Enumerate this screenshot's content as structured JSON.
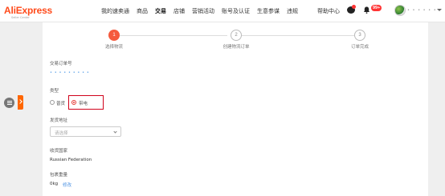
{
  "header": {
    "logo_text": "AliExpress",
    "logo_sub": "Seller Center",
    "nav": [
      "我的速卖通",
      "商品",
      "交易",
      "店铺",
      "营销活动",
      "账号及认证",
      "生意参谋",
      "违规"
    ],
    "active_nav": "交易",
    "help": "帮助中心",
    "notification_badge": "99+",
    "username_masked": "• • • • • •"
  },
  "stepper": {
    "steps": [
      {
        "number": "1",
        "label": "选择物流",
        "state": "active"
      },
      {
        "number": "2",
        "label": "创建物流订单",
        "state": "inactive"
      },
      {
        "number": "3",
        "label": "订单完成",
        "state": "inactive"
      }
    ]
  },
  "form": {
    "order_no_label": "交易订单号",
    "order_no_value": "• • • • • • • • •",
    "category_label": "类型",
    "category_options": [
      "普货",
      "带电"
    ],
    "category_selected": "带电",
    "ship_address_label": "发货地址",
    "ship_address_placeholder": "请选择",
    "country_label": "收货国家",
    "country_value": "Russian Federation",
    "weight_label": "包裹重量",
    "weight_value": "0kg",
    "edit_label": "修改"
  },
  "colors": {
    "brand": "#ff4a1a",
    "accent": "#f55a3d",
    "highlight": "#d0021b",
    "link": "#4a90e2"
  }
}
